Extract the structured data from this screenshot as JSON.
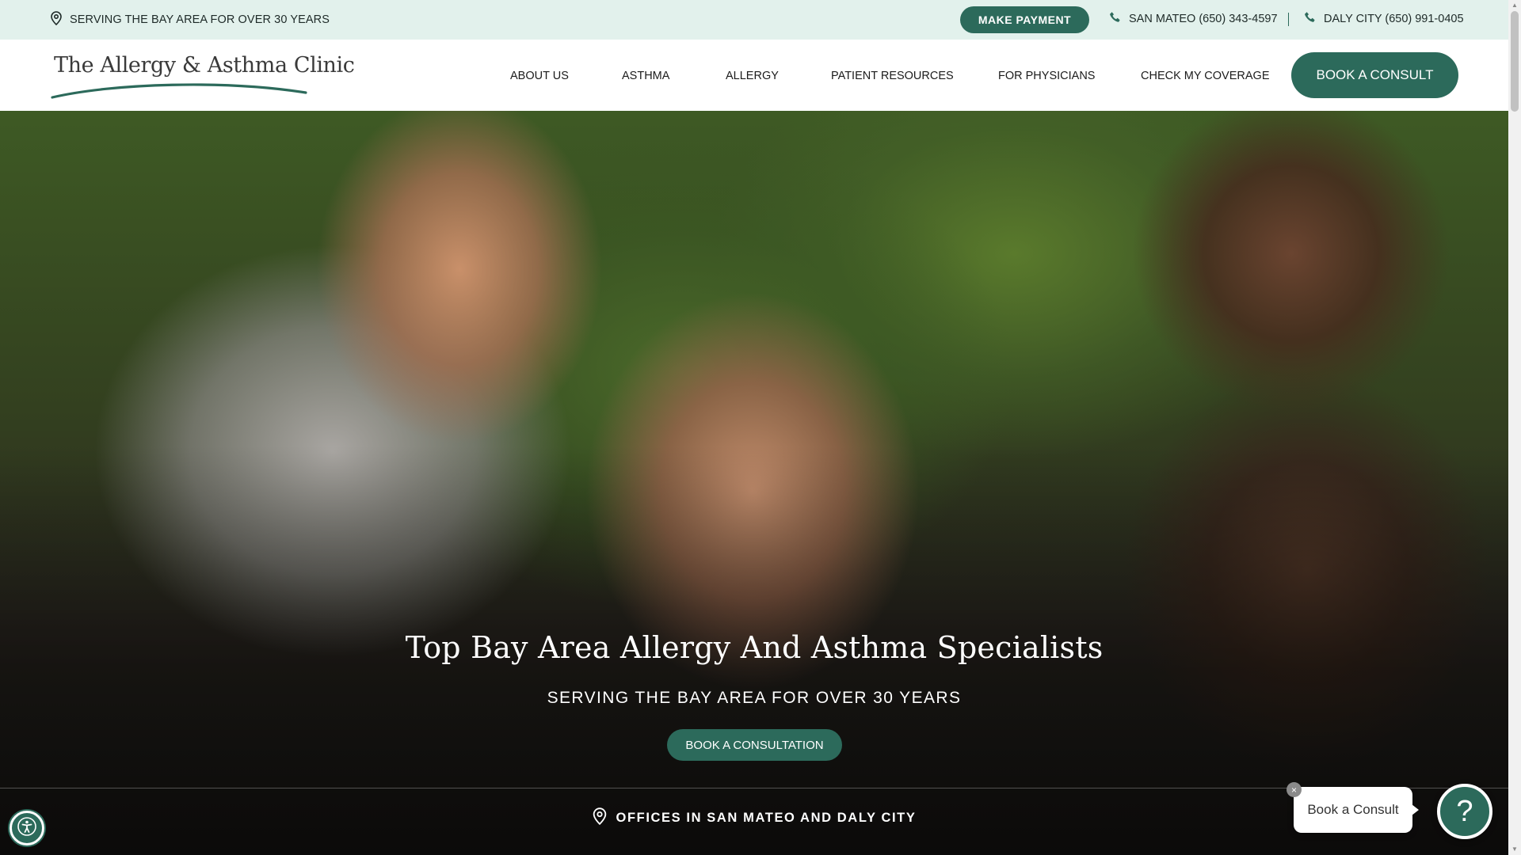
{
  "topbar": {
    "location_text": "SERVING THE BAY AREA FOR OVER 30 YEARS",
    "payment_label": "MAKE PAYMENT",
    "phone_san_mateo": "SAN MATEO (650) 343-4597",
    "phone_daly_city": "DALY CITY (650) 991-0405"
  },
  "nav": {
    "logo_text": "The Allergy & Asthma Clinic",
    "items": [
      {
        "label": "ABOUT US"
      },
      {
        "label": "ASTHMA"
      },
      {
        "label": "ALLERGY"
      },
      {
        "label": "PATIENT RESOURCES"
      },
      {
        "label": "FOR PHYSICIANS"
      },
      {
        "label": "CHECK MY COVERAGE"
      }
    ],
    "cta_label": "BOOK A CONSULT"
  },
  "hero": {
    "title": "Top Bay Area Allergy And Asthma Specialists",
    "subtitle": "SERVING THE BAY AREA FOR OVER 30 YEARS",
    "button_label": "BOOK A CONSULTATION",
    "offices_text": "OFFICES IN SAN MATEO AND DALY CITY"
  },
  "widgets": {
    "chat_bubble_text": "Book a Consult",
    "chat_close_glyph": "×",
    "chat_button_glyph": "?"
  },
  "icons": [
    "map-pin-icon",
    "phone-icon",
    "accessibility-icon",
    "help-icon",
    "close-icon"
  ],
  "colors": {
    "brand_green": "#2c6a5b",
    "topbar_bg": "#e2f1ec",
    "text_dark": "#1e2a28"
  }
}
